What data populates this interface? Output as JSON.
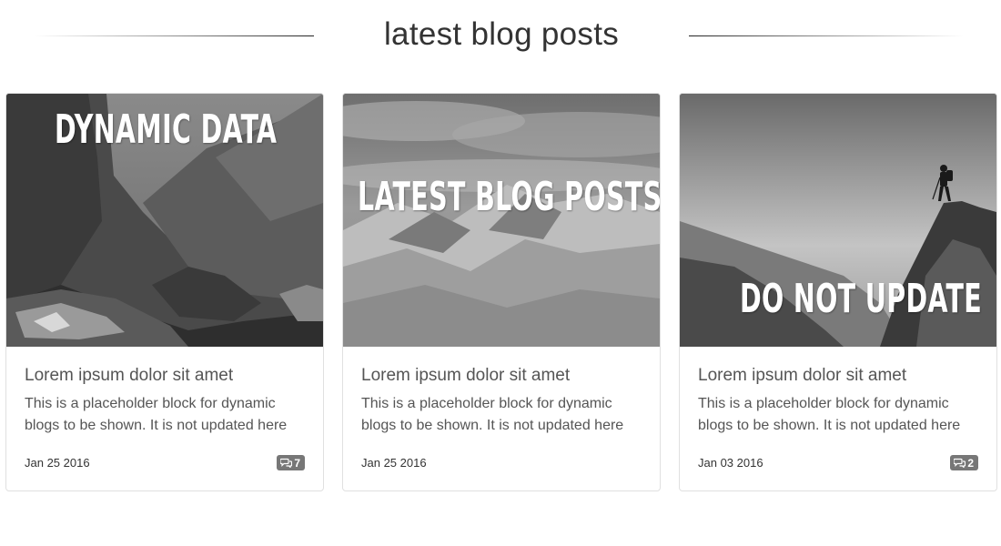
{
  "section": {
    "title": "latest blog posts"
  },
  "posts": [
    {
      "image_caption": "DYNAMIC DATA",
      "image_desc": "mountain-canyon-photo",
      "title": "Lorem ipsum dolor sit amet",
      "text": "This is a placeholder block for dynamic blogs to be shown. It is not updated here",
      "date": "Jan 25 2016",
      "comment_count": "7"
    },
    {
      "image_caption": "LATEST BLOG POSTS",
      "image_desc": "snowy-peaks-clouds-photo",
      "title": "Lorem ipsum dolor sit amet",
      "text": "This is a placeholder block for dynamic blogs to be shown. It is not updated here",
      "date": "Jan 25 2016",
      "comment_count": ""
    },
    {
      "image_caption": "DO NOT UPDATE",
      "image_desc": "hiker-on-ridge-photo",
      "title": "Lorem ipsum dolor sit amet",
      "text": "This is a placeholder block for dynamic blogs to be shown. It is not updated here",
      "date": "Jan 03 2016",
      "comment_count": "2"
    }
  ],
  "icons": {
    "comment": "comments-icon"
  },
  "colors": {
    "badge": "#777777",
    "title": "#333333",
    "text": "#555555"
  }
}
